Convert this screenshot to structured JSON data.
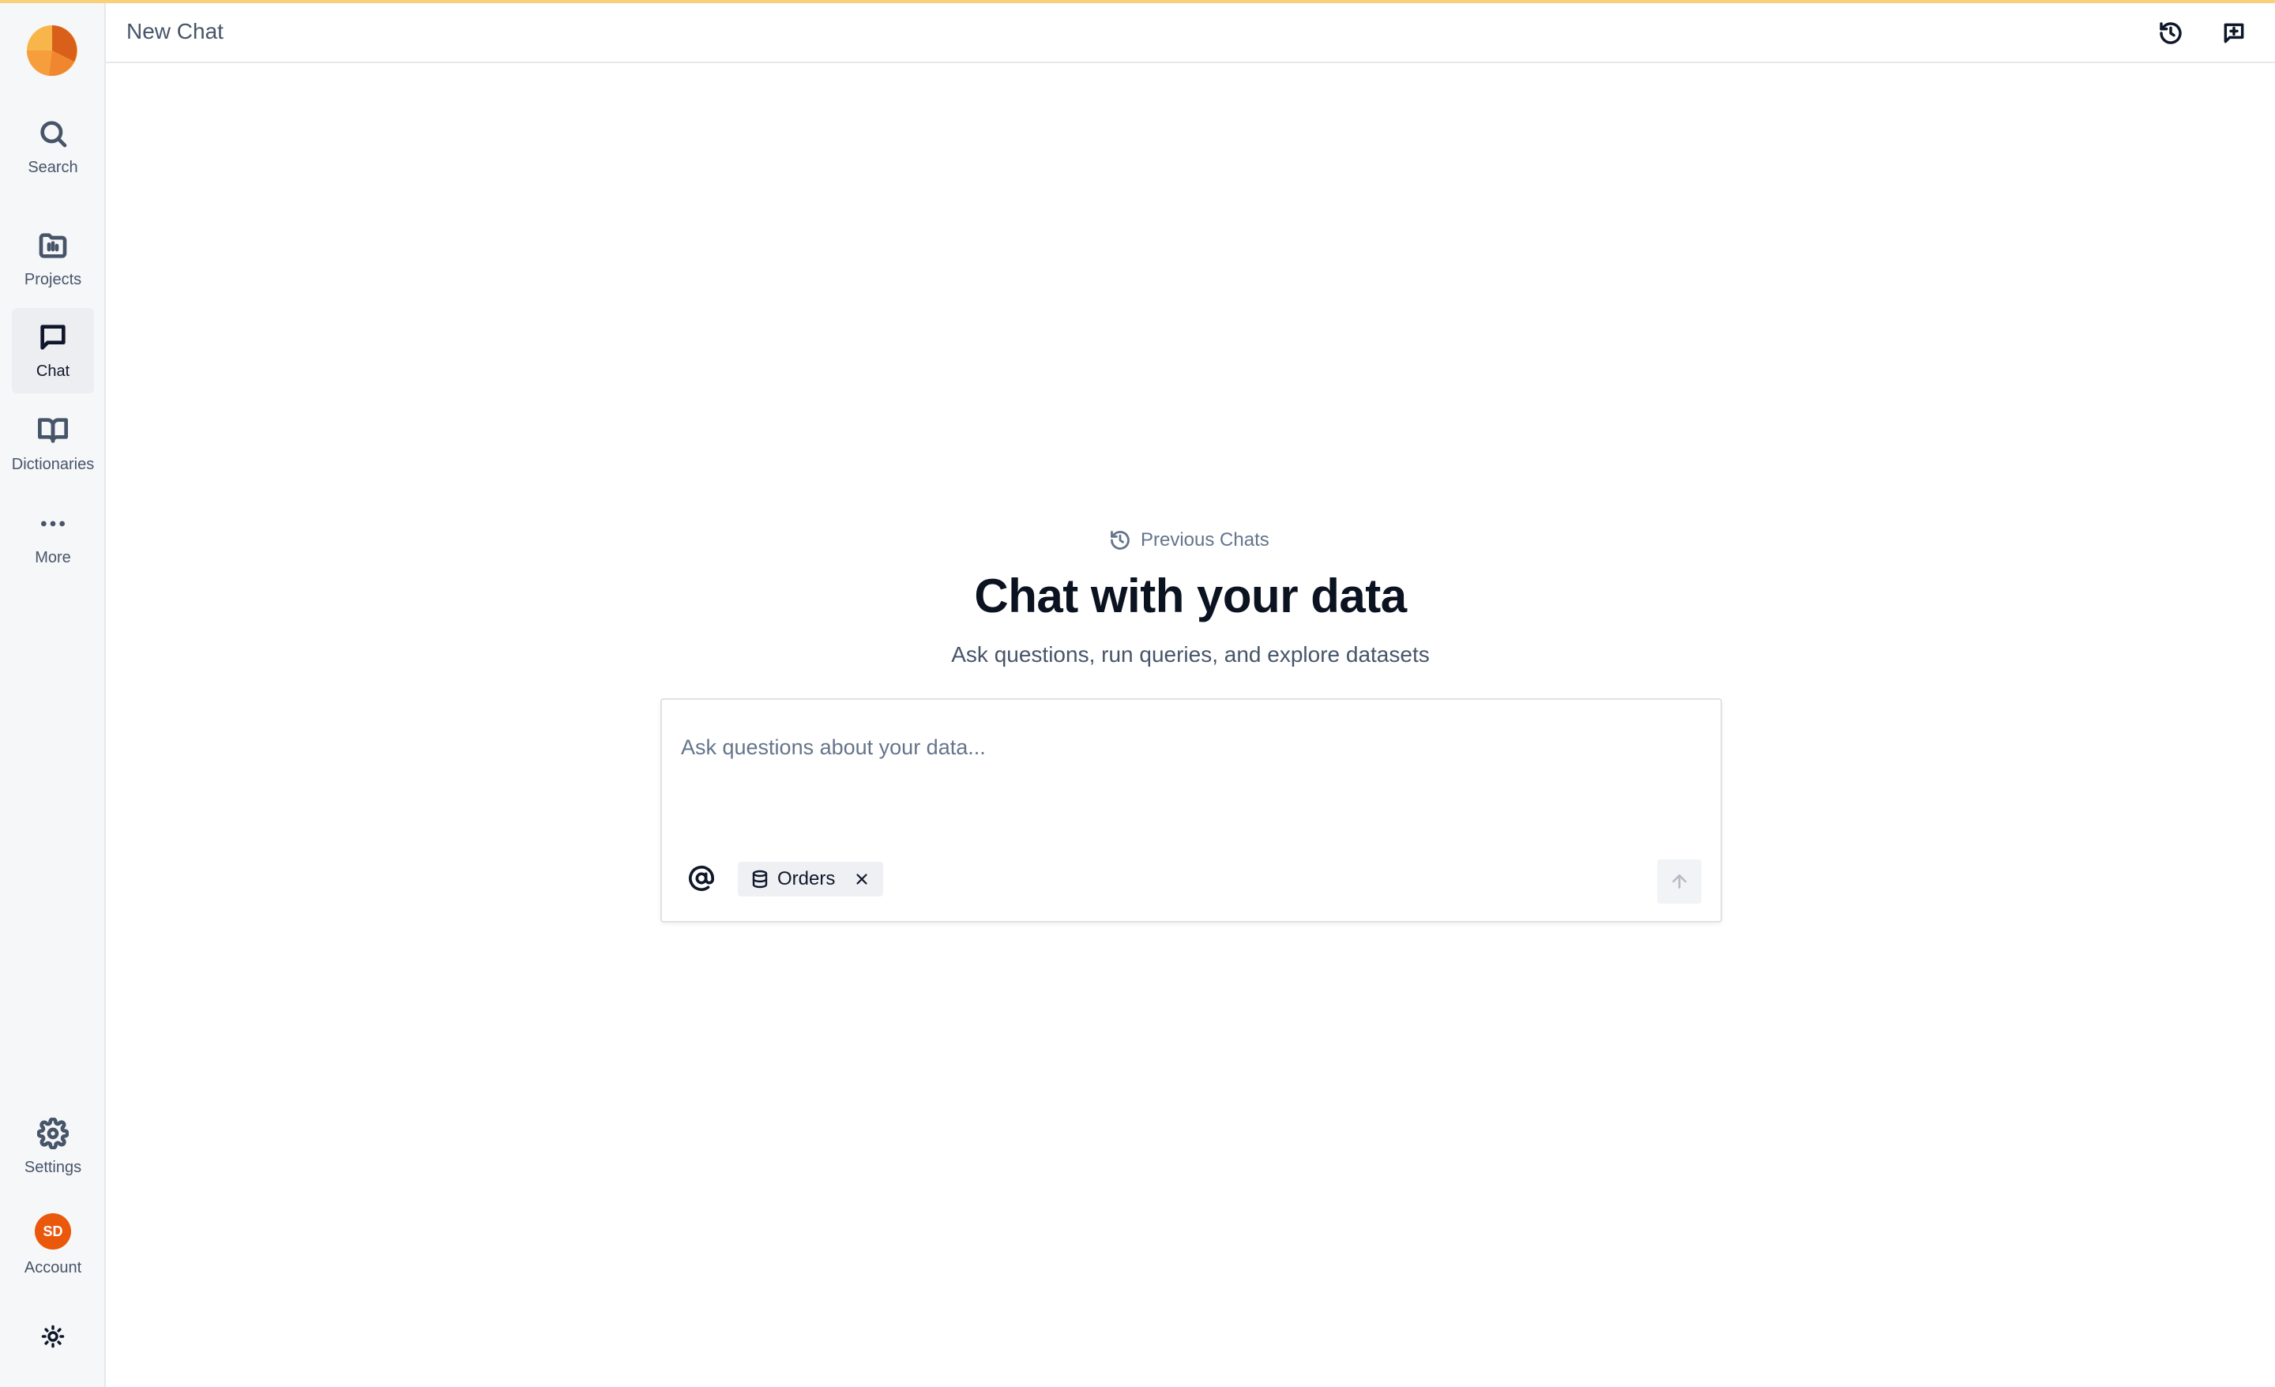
{
  "app": {
    "brand_colors": {
      "logo_light": "#f8b54a",
      "logo_mid": "#f59e3b",
      "logo_dark": "#d9601a"
    }
  },
  "header": {
    "title": "New Chat",
    "history_icon": "history-icon",
    "new_chat_icon": "new-chat-icon"
  },
  "sidebar": {
    "items": [
      {
        "label": "Search",
        "icon": "search-icon"
      },
      {
        "label": "Projects",
        "icon": "folder-icon"
      },
      {
        "label": "Chat",
        "icon": "chat-bubble-icon",
        "active": true
      },
      {
        "label": "Dictionaries",
        "icon": "book-icon"
      },
      {
        "label": "More",
        "icon": "more-dots-icon"
      }
    ],
    "bottom": {
      "settings_label": "Settings",
      "account_label": "Account",
      "avatar_initials": "SD",
      "avatar_color": "#ea580c",
      "theme_icon": "sun-icon"
    }
  },
  "main": {
    "previous_chats_label": "Previous Chats",
    "title": "Chat with your data",
    "subtitle": "Ask questions, run queries, and explore datasets",
    "composer": {
      "placeholder": "Ask questions about your data...",
      "value": "",
      "mention_icon": "at-sign-icon",
      "context_chips": [
        {
          "label": "Orders",
          "icon": "database-icon"
        }
      ],
      "send_icon": "arrow-up-icon"
    }
  }
}
